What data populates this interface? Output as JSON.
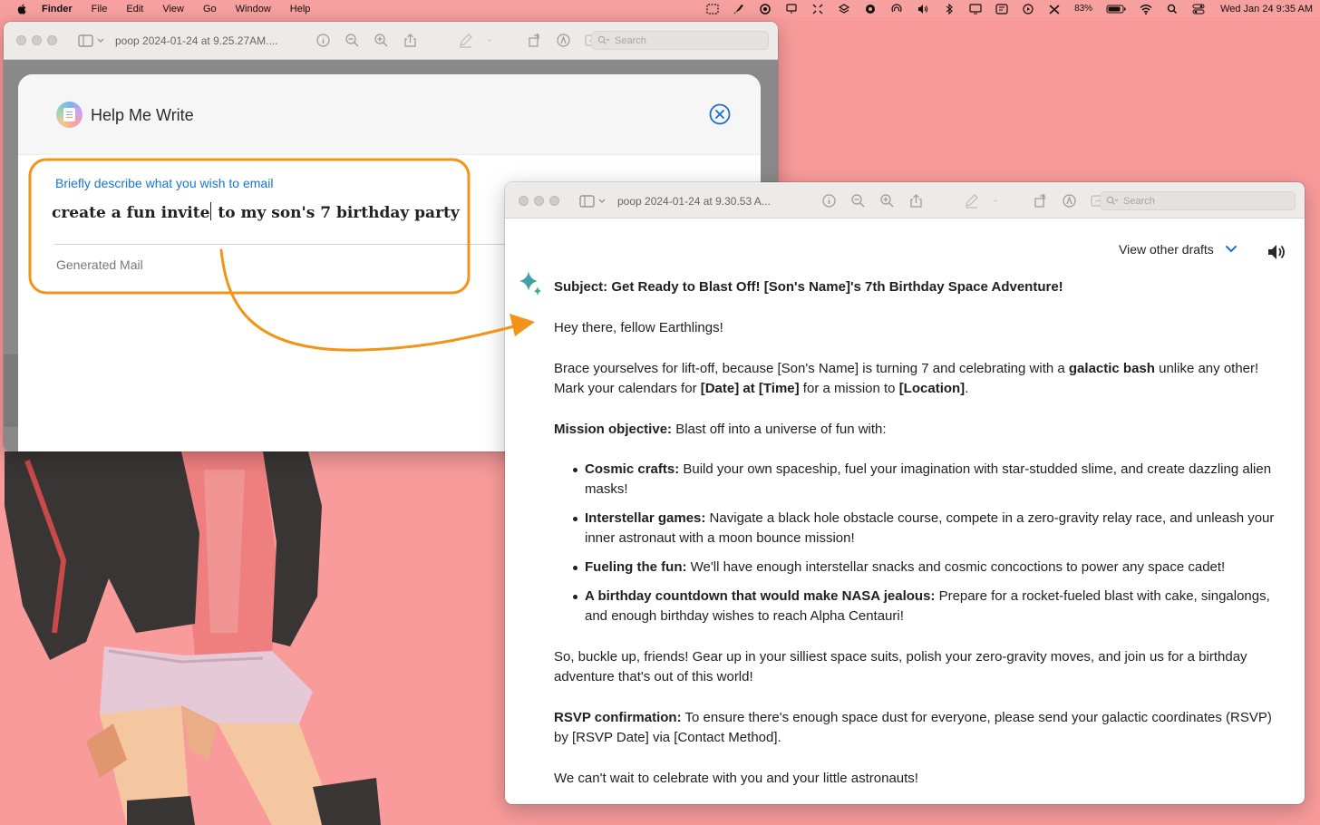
{
  "menubar": {
    "app_name": "Finder",
    "items": [
      "File",
      "Edit",
      "View",
      "Go",
      "Window",
      "Help"
    ],
    "battery": "83%",
    "datetime": "Wed Jan 24  9:35 AM"
  },
  "window_back": {
    "filename": "poop 2024-01-24 at 9.25.27AM....",
    "search_placeholder": "Search"
  },
  "help_me_write": {
    "title": "Help Me Write",
    "describe_label": "Briefly describe what you wish to email",
    "prompt_before_caret": "create a fun invite",
    "prompt_after_caret": " to my son's 7 birthday party",
    "generated_label": "Generated Mail"
  },
  "window_front": {
    "filename": "poop 2024-01-24 at 9.30.53 A...",
    "search_placeholder": "Search"
  },
  "email": {
    "view_other_drafts": "View other drafts",
    "subject": "Subject: Get Ready to Blast Off! [Son's Name]'s 7th Birthday Space Adventure!",
    "greeting": "Hey there, fellow Earthlings!",
    "intro_1": "Brace yourselves for lift-off, because [Son's Name] is turning 7 and celebrating with a ",
    "intro_bold_1": "galactic bash",
    "intro_2": " unlike any other! Mark your calendars for ",
    "intro_bold_2": "[Date] at [Time]",
    "intro_3": " for a mission to ",
    "intro_bold_3": "[Location]",
    "intro_4": ".",
    "mission_label": "Mission objective:",
    "mission_text": " Blast off into a universe of fun with:",
    "bullets": [
      {
        "label": "Cosmic crafts:",
        "text": " Build your own spaceship, fuel your imagination with star-studded slime, and create dazzling alien masks!"
      },
      {
        "label": "Interstellar games:",
        "text": " Navigate a black hole obstacle course, compete in a zero-gravity relay race, and unleash your inner astronaut with a moon bounce mission!"
      },
      {
        "label": "Fueling the fun:",
        "text": " We'll have enough interstellar snacks and cosmic concoctions to power any space cadet!"
      },
      {
        "label": "A birthday countdown that would make NASA jealous:",
        "text": " Prepare for a rocket-fueled blast with cake, singalongs, and enough birthday wishes to reach Alpha Centauri!"
      }
    ],
    "closing_para": "So, buckle up, friends! Gear up in your silliest space suits, polish your zero-gravity moves, and join us for a birthday adventure that's out of this world!",
    "rsvp_label": "RSVP confirmation:",
    "rsvp_text": " To ensure there's enough space dust for everyone, please send your galactic coordinates (RSVP) by [RSVP Date] via [Contact Method].",
    "signoff": "We can't wait to celebrate with you and your little astronauts!"
  },
  "icons": {
    "apple": "apple-logo-icon",
    "sidebar": "sidebar-toggle-icon",
    "info": "info-icon",
    "zoom_out": "zoom-out-icon",
    "zoom_in": "zoom-in-icon",
    "share": "share-icon",
    "markup": "markup-pen-icon",
    "rotate": "rotate-icon",
    "annotate": "annotate-icon",
    "signature": "signature-icon",
    "close": "close-circle-icon",
    "sparkle": "gemini-sparkle-icon",
    "speaker": "speaker-icon",
    "chevron": "chevron-down-icon"
  },
  "colors": {
    "desktop": "#f99b9b",
    "highlight_orange": "#f39318",
    "link_blue": "#1876d1",
    "close_blue": "#1a6fd0"
  }
}
